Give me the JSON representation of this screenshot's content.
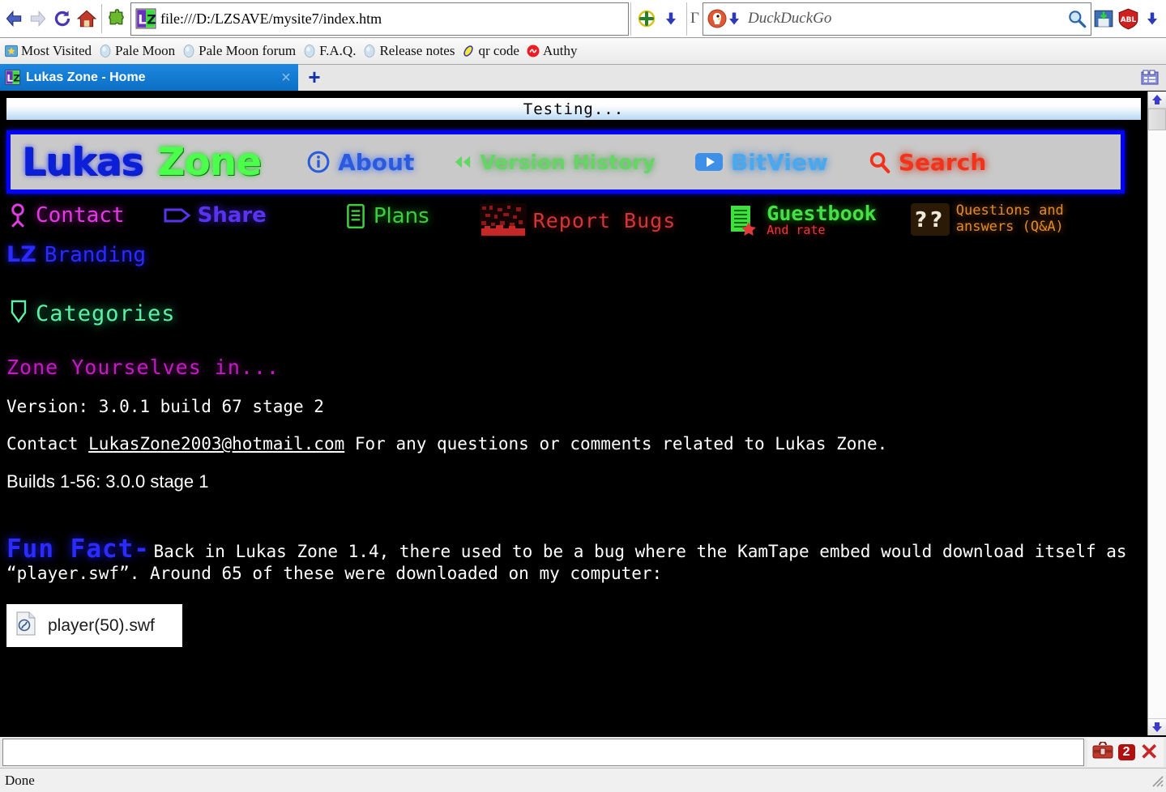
{
  "browser": {
    "nav": {
      "back_icon": "back-arrow-icon",
      "forward_icon": "forward-arrow-icon",
      "reload_icon": "reload-icon",
      "home_icon": "home-icon",
      "addon_icon": "puzzle-piece-icon"
    },
    "url": {
      "value": "file:///D:/LZSAVE/mysite7/index.htm",
      "favicon": "lukas-zone-favicon"
    },
    "toolbar_right": {
      "addon_install_icon": "addon-install-icon",
      "addon_dropdown_icon": "dropdown-arrow-icon",
      "separator": "Г"
    },
    "search": {
      "engine": "DuckDuckGo",
      "placeholder": "DuckDuckGo",
      "engine_icon": "duckduckgo-icon",
      "go_icon": "magnifier-icon",
      "save_icon": "save-page-icon",
      "adblock_icon": "adblock-shield-icon",
      "adblock_label": "ABL"
    },
    "bookmarks": [
      {
        "label": "Most Visited",
        "icon": "star-folder-icon"
      },
      {
        "label": "Pale Moon",
        "icon": "palemoon-icon"
      },
      {
        "label": "Pale Moon forum",
        "icon": "palemoon-icon"
      },
      {
        "label": "F.A.Q.",
        "icon": "palemoon-icon"
      },
      {
        "label": "Release notes",
        "icon": "palemoon-icon"
      },
      {
        "label": "qr code",
        "icon": "link-ring-icon"
      },
      {
        "label": "Authy",
        "icon": "authy-icon"
      }
    ],
    "tabs": [
      {
        "title": "Lukas Zone - Home",
        "favicon": "lukas-zone-favicon",
        "close_label": "×",
        "active": true
      }
    ],
    "new_tab_label": "+",
    "tab_list_icon": "tab-list-icon",
    "findbar": {
      "value": "",
      "toolbox_icon": "toolbox-icon",
      "badge_count": "2",
      "close_label": "✕"
    },
    "status": {
      "text": "Done"
    }
  },
  "page": {
    "marquee": "Testing...",
    "header": {
      "logo_part1": "Lukas",
      "logo_part2": "Zone",
      "links": [
        {
          "label": "About",
          "icon": "info-circle-icon"
        },
        {
          "label": "Version History",
          "icon": "rewind-icon"
        },
        {
          "label": "BitView",
          "icon": "play-button-icon"
        },
        {
          "label": "Search",
          "icon": "magnifier-icon"
        }
      ]
    },
    "subnav": [
      {
        "label": "Contact",
        "icon": "person-icon"
      },
      {
        "label": "Share",
        "icon": "share-tag-icon"
      },
      {
        "label": "Plans",
        "icon": "document-list-icon"
      },
      {
        "label": "Report Bugs",
        "icon": "bug-noise-icon"
      },
      {
        "label": "Guestbook",
        "sublabel": "And rate",
        "icon": "guestbook-page-star-icon"
      },
      {
        "label_line1": "Questions and",
        "label_line2": "answers (Q&A)",
        "icon": "question-marks-icon"
      },
      {
        "label": "Branding",
        "icon": "lz-mark-icon"
      }
    ],
    "categories": {
      "label": "Categories",
      "icon": "shield-icon"
    },
    "headline": "Zone Yourselves in...",
    "version_line": "Version: 3.0.1 build 67 stage 2",
    "contact": {
      "prefix": "Contact ",
      "email": "LukasZone2003@hotmail.com",
      "suffix": " For any questions or comments related to Lukas Zone."
    },
    "builds_line": "Builds 1-56: 3.0.0 stage 1",
    "fun_fact": {
      "label": "Fun Fact-",
      "text": "Back in Lukas Zone 1.4, there used to be a bug where the KamTape embed would download itself as “player.swf”. Around 65 of these were downloaded on my computer:"
    },
    "file_item": {
      "name": "player(50).swf",
      "icon": "swf-file-icon"
    }
  },
  "colors": {
    "logo_blue": "#0b1fd6",
    "logo_green": "#4dff4d",
    "header_bg": "#c9c9c9",
    "header_border": "#0000ff",
    "page_bg": "#000000",
    "tab_active": "#0c6fc4",
    "accent_red": "#b01010"
  }
}
